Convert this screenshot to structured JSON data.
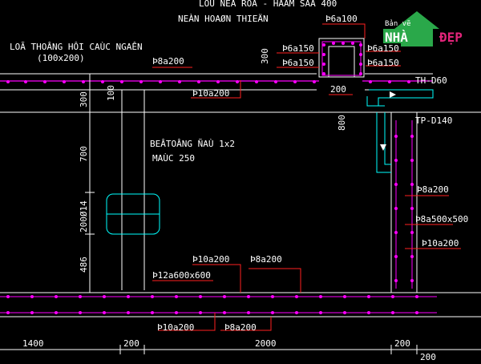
{
  "labels": {
    "top_cut": "LÔÙ NEÀ ROÄ - HAÀM SAÂ 400",
    "neo": "NEÀN HOAØN THIEÄN",
    "vent": "LOÃ THOÂNG HÔI CAÙC NGAÊN",
    "vent_size": "(100x200)",
    "concrete": "BEÂTOÂNG ÑAÙ 1x2",
    "grade": "MAÙC 250",
    "th": "TH-D60",
    "tp": "TP-D140"
  },
  "rebar": {
    "r_top1": "Þ6a100",
    "r_top2": "Þ6a150",
    "r_top3": "Þ6a150",
    "r_top4": "Þ6a150",
    "r_top5": "Þ6a150",
    "r_slab1": "Þ8a200",
    "r_slab2": "Þ10a200",
    "r_wall1": "Þ8a200",
    "r_wall2": "Þ8a500x500",
    "r_wall3": "Þ10a200",
    "r_bot1": "Þ10a200",
    "r_bot2": "Þ8a200",
    "r_bot3": "Þ12a600x600",
    "r_bot4": "Þ10a200",
    "r_bot5": "Þ8a200"
  },
  "dims": {
    "d300a": "300",
    "d300b": "300",
    "d100": "100",
    "d200_top": "200",
    "d800": "800",
    "d700": "700",
    "d200_14": "200Ø14",
    "d486": "486",
    "d1400": "1400",
    "d200_b1": "200",
    "d2000": "2000",
    "d200_b2": "200",
    "d200_b3": "200"
  },
  "logo": {
    "line1": "Bản vẽ",
    "line2": "NHÀ",
    "line3": "ĐẸP"
  },
  "colors": {
    "background": "#000000",
    "structure": "#ffffff",
    "rebar": "#ff00ff",
    "leader": "#ff2020",
    "hidden": "#00ffff",
    "dim": "#00ff00",
    "logo_green": "#2aa84a",
    "logo_pink": "#e3247a"
  }
}
